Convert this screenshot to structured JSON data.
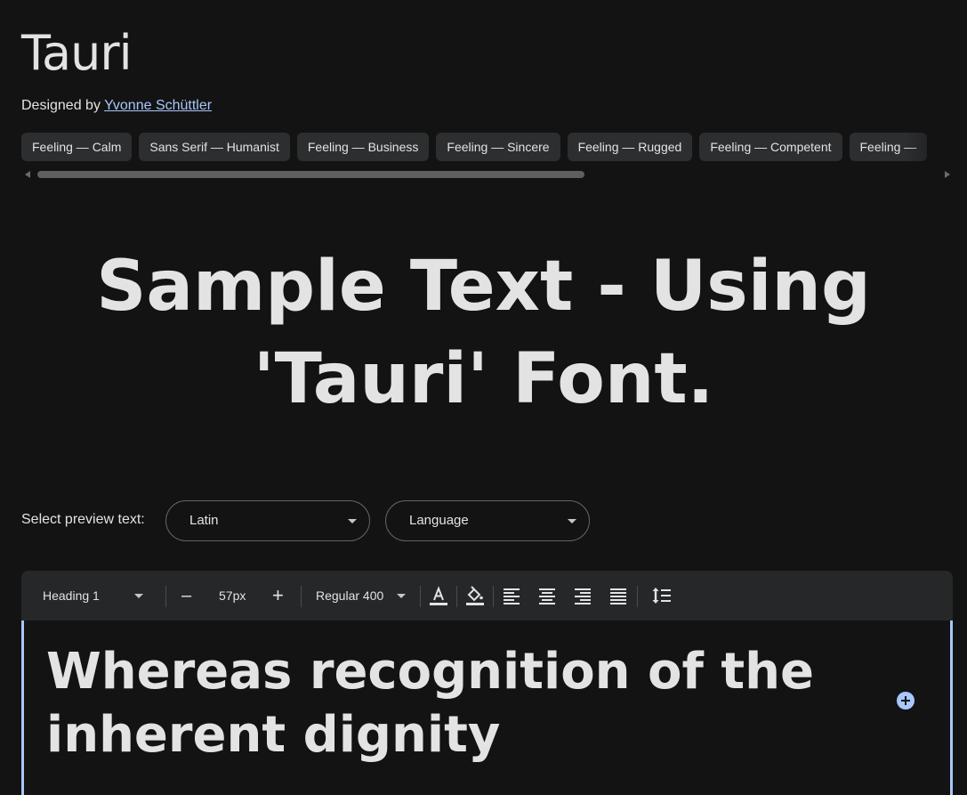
{
  "font": {
    "family_name": "Tauri",
    "designed_by_prefix": "Designed by",
    "designer_name": "Yvonne Schüttler"
  },
  "tags": [
    {
      "label": "Feeling — Calm"
    },
    {
      "label": "Sans Serif — Humanist"
    },
    {
      "label": "Feeling — Business"
    },
    {
      "label": "Feeling — Sincere"
    },
    {
      "label": "Feeling — Rugged"
    },
    {
      "label": "Feeling — Competent"
    },
    {
      "label": "Feeling — "
    }
  ],
  "hero": {
    "sample_text": "Sample Text - Using 'Tauri' Font."
  },
  "preview": {
    "label": "Select preview text:",
    "script_value": "Latin",
    "language_placeholder": "Language"
  },
  "toolbar": {
    "style_value": "Heading 1",
    "decrease_label": "–",
    "size_value": "57px",
    "increase_label": "+",
    "weight_value": "Regular 400"
  },
  "editor": {
    "text": "Whereas recognition of the inherent dignity"
  },
  "colors": {
    "background": "#131314",
    "chip_bg": "#2d2e30",
    "toolbar_bg": "#262729",
    "link": "#a8c7fa",
    "accent": "#a8c7fa",
    "text": "#e3e3e3"
  },
  "icons": {
    "text_color": "text-color-icon",
    "fill_color": "paint-bucket-icon",
    "align_left": "align-left-icon",
    "align_center": "align-center-icon",
    "align_right": "align-right-icon",
    "justify": "align-justify-icon",
    "line_height": "line-height-icon",
    "add": "add-circle-icon"
  }
}
